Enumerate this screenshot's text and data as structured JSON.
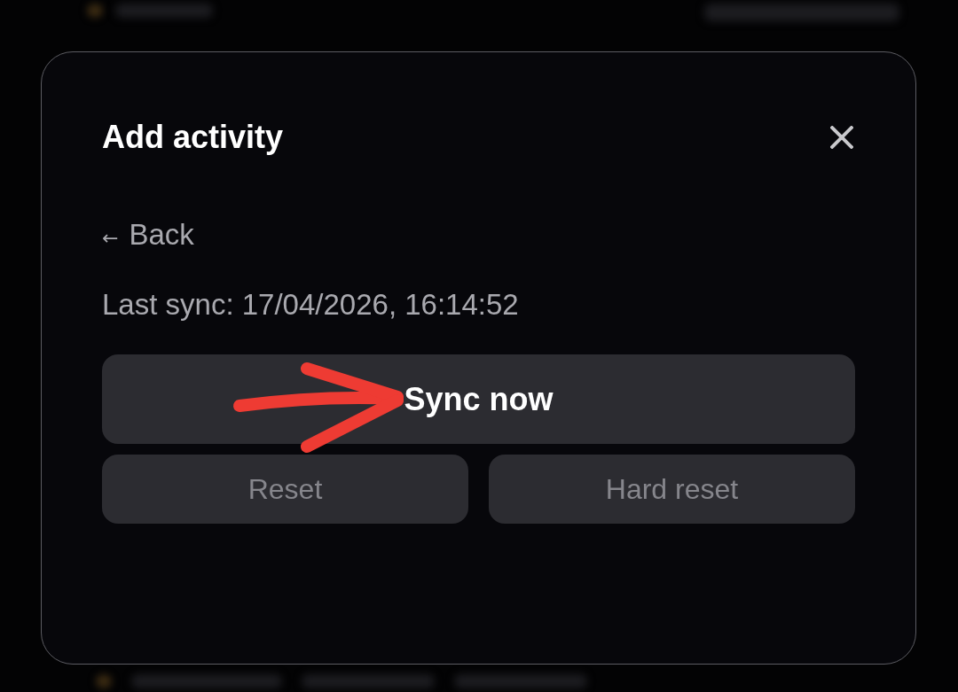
{
  "dialog": {
    "title": "Add activity",
    "back": {
      "icon": "←",
      "label": "Back"
    },
    "last_sync": "Last sync: 17/04/2026, 16:14:52",
    "buttons": [
      {
        "label": "Sync now",
        "kind": "primary",
        "disabled": false
      },
      {
        "label": "Reset",
        "kind": "secondary",
        "disabled": true
      },
      {
        "label": "Hard reset",
        "kind": "secondary",
        "disabled": true
      }
    ]
  }
}
